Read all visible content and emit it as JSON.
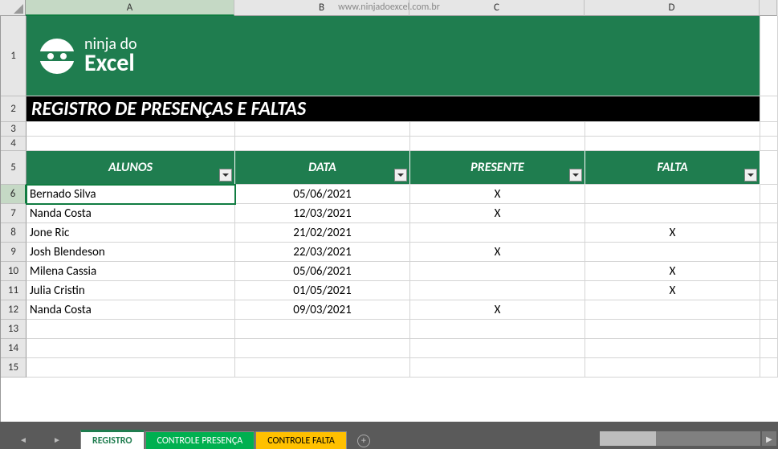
{
  "watermark": "www.ninjadoexcel.com.br",
  "columns": [
    "A",
    "B",
    "C",
    "D"
  ],
  "logo": {
    "line1": "ninja do",
    "line2": "Excel"
  },
  "title": "REGISTRO DE PRESENÇAS E FALTAS",
  "headers": {
    "alunos": "ALUNOS",
    "data": "DATA",
    "presente": "PRESENTE",
    "falta": "FALTA"
  },
  "rows": [
    {
      "n": "6",
      "aluno": "Bernado Silva",
      "data": "05/06/2021",
      "presente": "X",
      "falta": ""
    },
    {
      "n": "7",
      "aluno": "Nanda Costa",
      "data": "12/03/2021",
      "presente": "X",
      "falta": ""
    },
    {
      "n": "8",
      "aluno": "Jone Ric",
      "data": "21/02/2021",
      "presente": "",
      "falta": "X"
    },
    {
      "n": "9",
      "aluno": "Josh Blendeson",
      "data": "22/03/2021",
      "presente": "X",
      "falta": ""
    },
    {
      "n": "10",
      "aluno": "Milena Cassia",
      "data": "05/06/2021",
      "presente": "",
      "falta": "X"
    },
    {
      "n": "11",
      "aluno": "Julia Cristin",
      "data": "01/05/2021",
      "presente": "",
      "falta": "X"
    },
    {
      "n": "12",
      "aluno": "Nanda Costa",
      "data": "09/03/2021",
      "presente": "X",
      "falta": ""
    }
  ],
  "empty_rows": [
    "13",
    "14",
    "15"
  ],
  "static_row_labels": {
    "r1": "1",
    "r2": "2",
    "r3": "3",
    "r4": "4",
    "r5": "5"
  },
  "tabs": {
    "registro": "REGISTRO",
    "presenca": "CONTROLE PRESENÇA",
    "falta": "CONTROLE FALTA"
  },
  "active_cell": "A6"
}
